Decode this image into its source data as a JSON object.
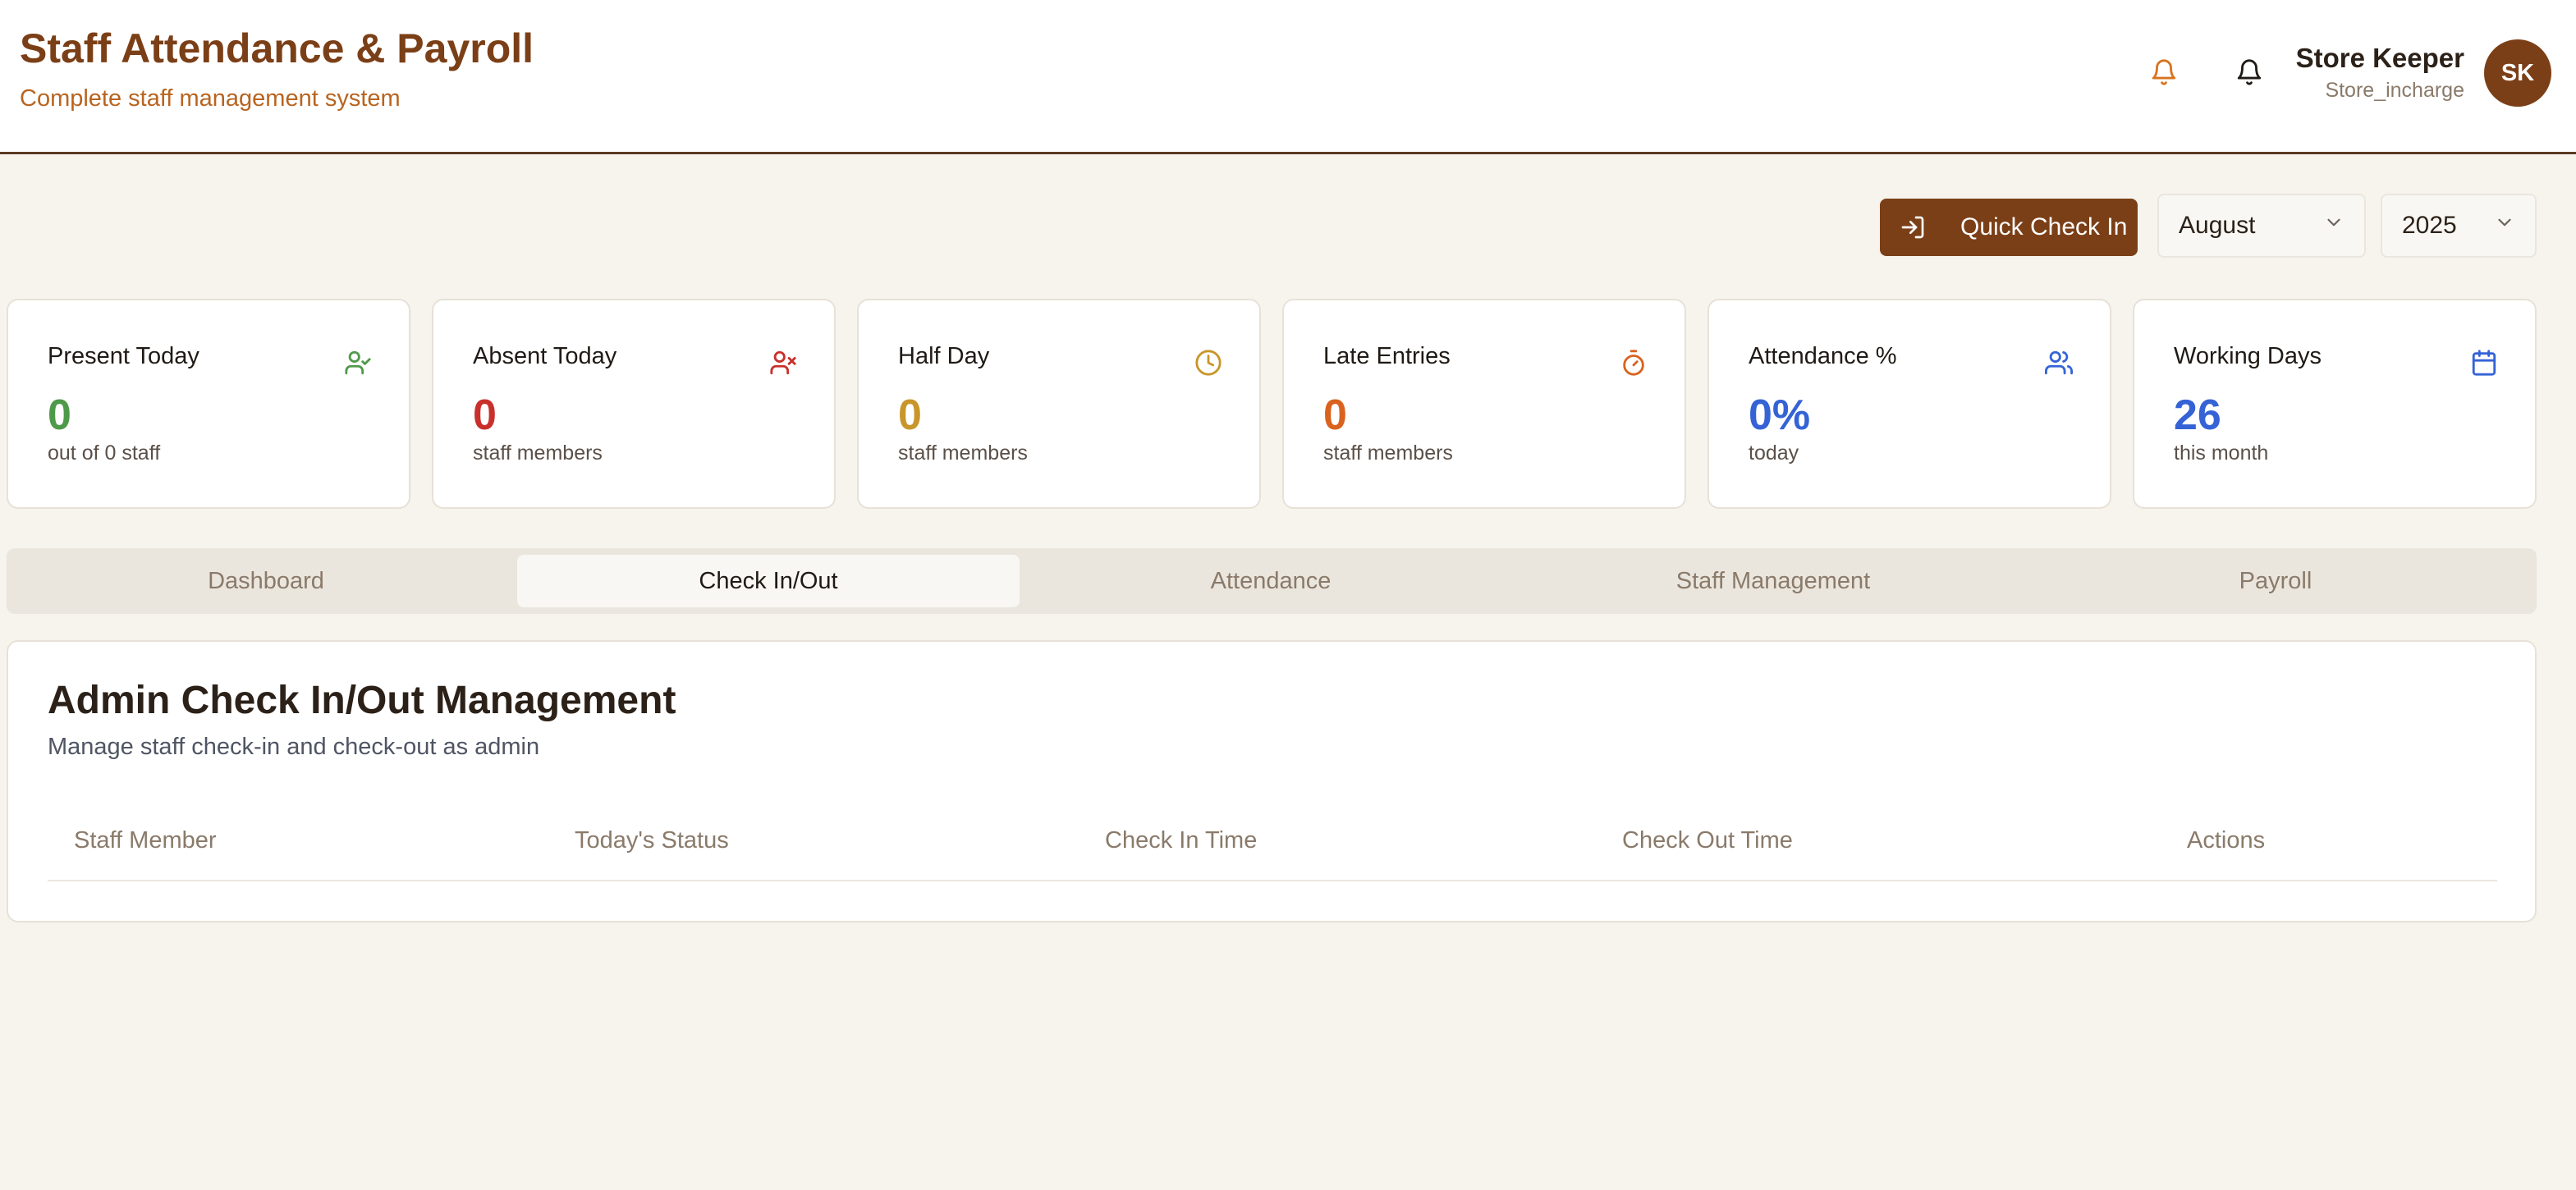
{
  "header": {
    "title": "Staff Attendance & Payroll",
    "subtitle": "Complete staff management system",
    "user_name": "Store Keeper",
    "user_role": "Store_incharge",
    "avatar_initials": "SK",
    "brand_color": "#7b3f17"
  },
  "toolbar": {
    "quick_checkin_label": "Quick Check In",
    "month": "August",
    "year": "2025"
  },
  "stats": [
    {
      "label": "Present Today",
      "value": "0",
      "sub": "out of 0 staff",
      "icon": "user-check-icon",
      "color": "#4f9a4a"
    },
    {
      "label": "Absent Today",
      "value": "0",
      "sub": "staff members",
      "icon": "user-x-icon",
      "color": "#c9302c"
    },
    {
      "label": "Half Day",
      "value": "0",
      "sub": "staff members",
      "icon": "clock-icon",
      "color": "#c8962a"
    },
    {
      "label": "Late Entries",
      "value": "0",
      "sub": "staff members",
      "icon": "timer-icon",
      "color": "#d9621e"
    },
    {
      "label": "Attendance %",
      "value": "0%",
      "sub": "today",
      "icon": "users-icon",
      "color": "#3563d6"
    },
    {
      "label": "Working Days",
      "value": "26",
      "sub": "this month",
      "icon": "calendar-icon",
      "color": "#3563d6"
    }
  ],
  "tabs": [
    {
      "label": "Dashboard",
      "active": false
    },
    {
      "label": "Check In/Out",
      "active": true
    },
    {
      "label": "Attendance",
      "active": false
    },
    {
      "label": "Staff Management",
      "active": false
    },
    {
      "label": "Payroll",
      "active": false
    }
  ],
  "panel": {
    "title": "Admin Check In/Out Management",
    "subtitle": "Manage staff check-in and check-out as admin",
    "columns": [
      "Staff Member",
      "Today's Status",
      "Check In Time",
      "Check Out Time",
      "Actions"
    ]
  }
}
